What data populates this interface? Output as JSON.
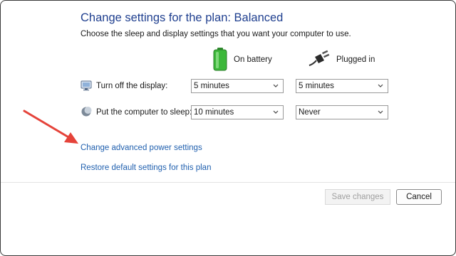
{
  "title": "Change settings for the plan: Balanced",
  "subtitle": "Choose the sleep and display settings that you want your computer to use.",
  "columns": {
    "battery": {
      "label": "On battery",
      "icon": "battery-icon"
    },
    "plugged": {
      "label": "Plugged in",
      "icon": "power-plug-icon"
    }
  },
  "rows": {
    "display": {
      "label": "Turn off the display:",
      "icon": "monitor-icon",
      "battery_value": "5 minutes",
      "plugged_value": "5 minutes"
    },
    "sleep": {
      "label": "Put the computer to sleep:",
      "icon": "sleep-moon-icon",
      "battery_value": "10 minutes",
      "plugged_value": "Never"
    }
  },
  "links": {
    "advanced": "Change advanced power settings",
    "restore": "Restore default settings for this plan"
  },
  "buttons": {
    "save": "Save changes",
    "cancel": "Cancel"
  },
  "annotation": {
    "type": "arrow",
    "color": "#e5433a",
    "points_to": "Change advanced power settings"
  },
  "colors": {
    "title": "#1f3f8f",
    "link": "#1f5fae",
    "battery_green": "#3cb83a"
  }
}
